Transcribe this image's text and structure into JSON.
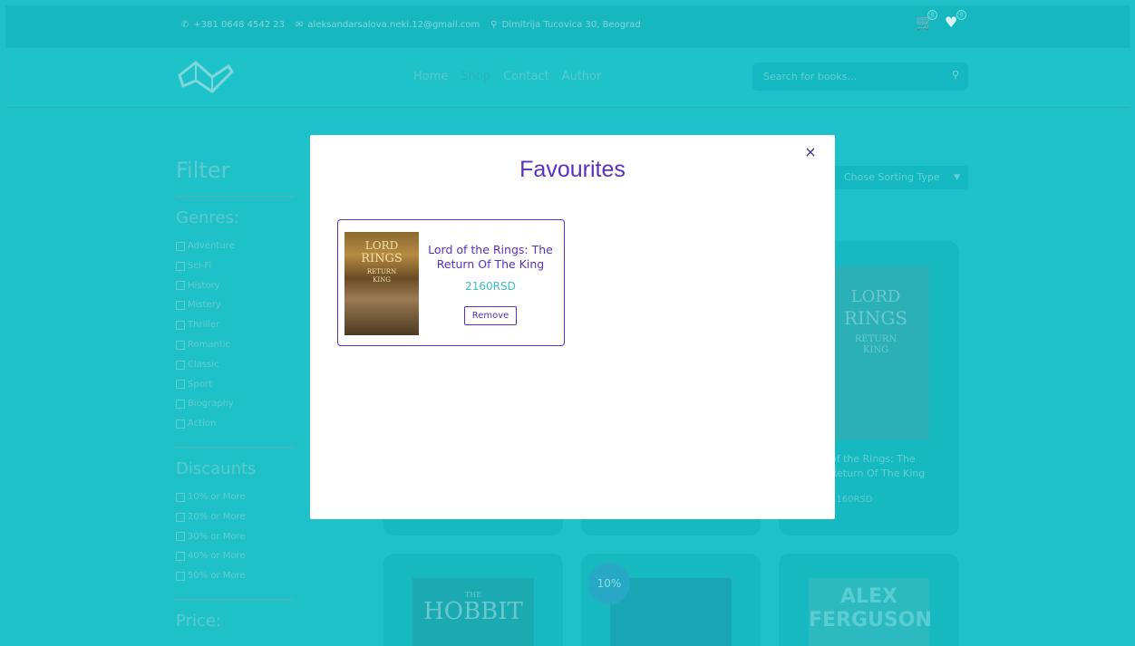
{
  "topbar": {
    "phone": "+381 0648 4542 23",
    "email": "aleksandarsalova.neki.12@gmail.com",
    "address": "Dimitrija Tucovica 30, Beograd",
    "cart_count": "0",
    "fav_count": "0",
    "icons": [
      "phone-icon",
      "mail-icon",
      "location-icon",
      "cart-icon",
      "heart-icon"
    ]
  },
  "nav": {
    "items": [
      "Home",
      "Shop",
      "Contact",
      "Author"
    ],
    "search_placeholder": "Search for books..."
  },
  "filter": {
    "title": "Filter",
    "genres_title": "Genres:",
    "genres": [
      "Adventure",
      "Sci-Fi",
      "History",
      "Mistery",
      "Thriller",
      "Romantic",
      "Classic",
      "Sport",
      "Biography",
      "Action"
    ],
    "discounts_title": "Discaunts",
    "discounts": [
      "10% or More",
      "20% or More",
      "30% or More",
      "40% or More",
      "50% or More"
    ],
    "price_title": "Price:"
  },
  "sort": {
    "selected": "Chose Sorting Type"
  },
  "cards": {
    "lotr_title_line1": "of the Rings: The",
    "lotr_title_line2": "Return Of The King",
    "lotr_price": "2160RSD",
    "hobbit_cover": "HOBBIT",
    "hobbit_cover_small": "THE",
    "discount_badge": "10%",
    "ferguson_line1": "ALEX",
    "ferguson_line2": "FERGUSON"
  },
  "modal": {
    "title": "Favourites",
    "close_label": "×",
    "items": [
      {
        "name": "Lord of the Rings: The Return Of The King",
        "price": "2160RSD",
        "remove_label": "Remove",
        "cover_line1": "LORD",
        "cover_line2": "RINGS",
        "cover_line3": "RETURN",
        "cover_line4": "KING"
      }
    ]
  },
  "colors": {
    "overlay_teal": "#1fc1c8",
    "accent_purple": "#5b2fc2",
    "price_teal": "#3dbfc7"
  }
}
